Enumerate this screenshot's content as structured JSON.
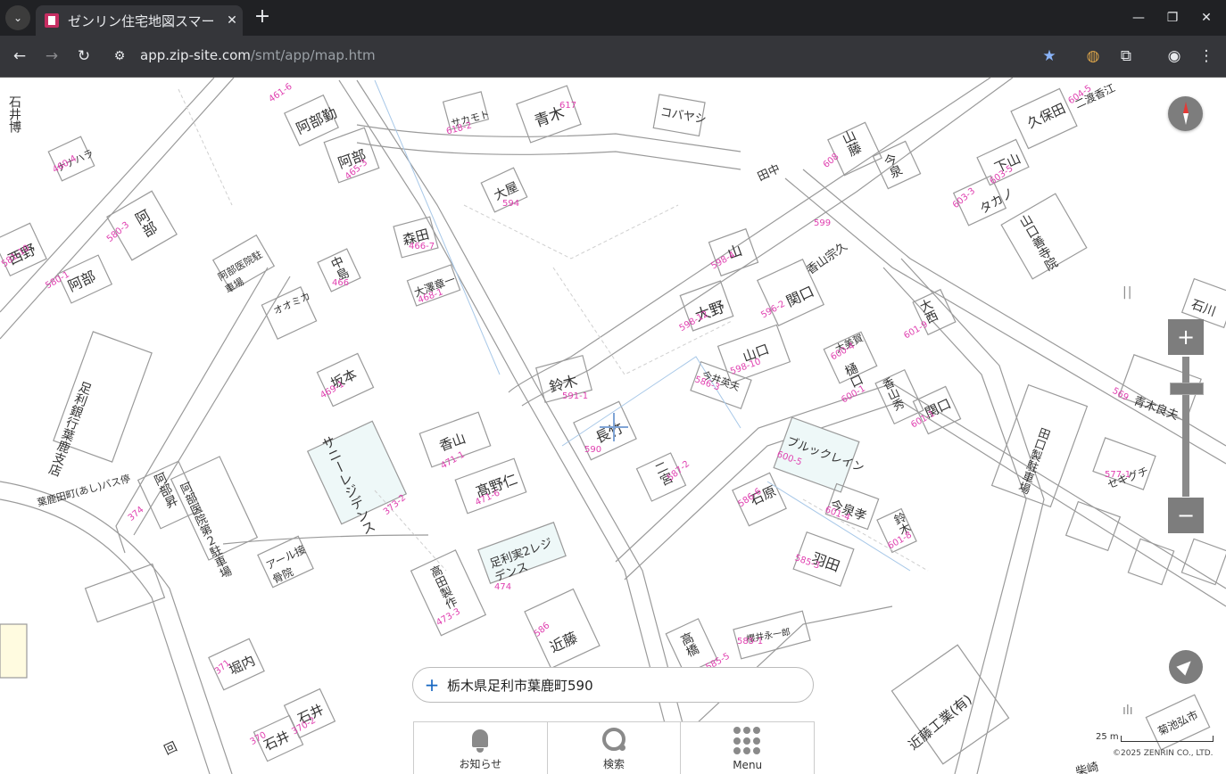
{
  "browser": {
    "tab_title": "ゼンリン住宅地図スマー",
    "tab_close": "✕",
    "new_tab": "+",
    "url_host": "app.zip-site.com",
    "url_path": "/smt/app/map.htm",
    "min": "—",
    "restore": "❐",
    "close": "✕"
  },
  "map": {
    "address": "栃木県足利市葉鹿町590",
    "zoom_in": "+",
    "zoom_out": "−",
    "scale_label": "25 m",
    "copyright": "©2025 ZENRIN CO., LTD.",
    "nav": [
      {
        "label": "お知らせ",
        "icon": "bell-icon"
      },
      {
        "label": "検索",
        "icon": "search-icon"
      },
      {
        "label": "Menu",
        "icon": "grid-icon"
      }
    ],
    "building_labels": [
      {
        "name": "サカモト",
        "num": "618-2"
      },
      {
        "name": "青木",
        "num": "617"
      },
      {
        "name": "コバヤシ",
        "num": ""
      },
      {
        "name": "阿部勤",
        "num": "461-6"
      },
      {
        "name": "阿部",
        "num": "465-3"
      },
      {
        "name": "ナナハラ",
        "num": "460-4"
      },
      {
        "name": "阿部",
        "num": "580-3"
      },
      {
        "name": "西野",
        "num": "581-10"
      },
      {
        "name": "阿部",
        "num": "580-1"
      },
      {
        "name": "阿部医院駐車場",
        "num": ""
      },
      {
        "name": "大屋",
        "num": "594"
      },
      {
        "name": "森田",
        "num": "466-7"
      },
      {
        "name": "中島",
        "num": "466"
      },
      {
        "name": "大澤章一",
        "num": "468-1"
      },
      {
        "name": "オオミカ",
        "num": ""
      },
      {
        "name": "坂本",
        "num": "469-1"
      },
      {
        "name": "香山",
        "num": "471-1"
      },
      {
        "name": "サニーレジデンス",
        "num": "373-2"
      },
      {
        "name": "髙野仁",
        "num": "471-6"
      },
      {
        "name": "鈴木",
        "num": "591-1"
      },
      {
        "name": "長竹",
        "num": "590"
      },
      {
        "name": "二宮",
        "num": "587-2"
      },
      {
        "name": "大野",
        "num": "598-12"
      },
      {
        "name": "山口",
        "num": "598-10"
      },
      {
        "name": "関口",
        "num": "596-2"
      },
      {
        "name": "山",
        "num": "598-4"
      },
      {
        "name": "田中",
        "num": ""
      },
      {
        "name": "香山宗久",
        "num": "599"
      },
      {
        "name": "今井英夫",
        "num": "586-3"
      },
      {
        "name": "山藤",
        "num": "608"
      },
      {
        "name": "今泉",
        "num": ""
      },
      {
        "name": "久保田",
        "num": ""
      },
      {
        "name": "下山",
        "num": "603-5"
      },
      {
        "name": "タカノ",
        "num": "603-3"
      },
      {
        "name": "二渡香江",
        "num": "604-5"
      },
      {
        "name": "大西",
        "num": "601-9"
      },
      {
        "name": "大美賀",
        "num": "600-4"
      },
      {
        "name": "樋口",
        "num": "600-1"
      },
      {
        "name": "香山秀",
        "num": ""
      },
      {
        "name": "関口",
        "num": "601-1"
      },
      {
        "name": "ブルックレイン",
        "num": "600-5"
      },
      {
        "name": "石原",
        "num": "586-6"
      },
      {
        "name": "今泉孝",
        "num": "601-4"
      },
      {
        "name": "鈴木",
        "num": "601-8"
      },
      {
        "name": "羽田",
        "num": "585-3"
      },
      {
        "name": "足利実2レジデンス",
        "num": "474"
      },
      {
        "name": "高田製作",
        "num": "473-3"
      },
      {
        "name": "近藤",
        "num": "586"
      },
      {
        "name": "高橋",
        "num": "585-5"
      },
      {
        "name": "櫻井永一郎",
        "num": "585-1"
      },
      {
        "name": "近藤工業(有)",
        "num": ""
      },
      {
        "name": "阿部昇",
        "num": "374"
      },
      {
        "name": "阿部医院第２駐車場",
        "num": ""
      },
      {
        "name": "アール接骨院",
        "num": ""
      },
      {
        "name": "堀内",
        "num": "371"
      },
      {
        "name": "石井",
        "num": "370-2"
      },
      {
        "name": "石井",
        "num": "370"
      },
      {
        "name": "足利銀行葉鹿支店",
        "num": ""
      },
      {
        "name": "葉鹿田町(あし)バス停",
        "num": ""
      },
      {
        "name": "石川",
        "num": ""
      },
      {
        "name": "青木良夫",
        "num": "569"
      },
      {
        "name": "セキグチ",
        "num": "577-1"
      },
      {
        "name": "田口製駐車場",
        "num": ""
      },
      {
        "name": "山口善寺院",
        "num": ""
      },
      {
        "name": "石井博",
        "num": ""
      },
      {
        "name": "菊池弘市",
        "num": ""
      },
      {
        "name": "柴崎",
        "num": ""
      },
      {
        "name": "回",
        "num": ""
      }
    ]
  }
}
